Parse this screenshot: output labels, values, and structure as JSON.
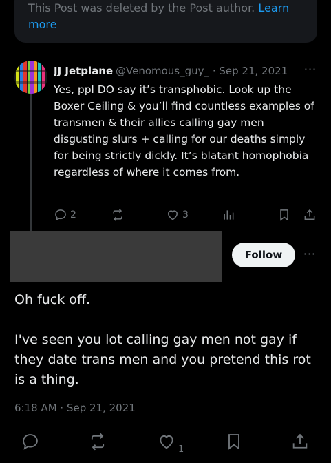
{
  "deleted_notice": {
    "text": "This Post was deleted by the Post author. ",
    "link": "Learn more"
  },
  "reply": {
    "name": "JJ Jetplane",
    "handle": "@Venomous_guy_",
    "separator": "·",
    "date": "Sep 21, 2021",
    "more": "···",
    "text": "Yes, ppl DO say it’s transphobic. Look up the Boxer Ceiling & you’ll find countless examples of transmen & their allies calling gay men disgusting slurs + calling for our deaths simply for being strictly dickly. It’s blatant homophobia regardless of where it comes from.",
    "actions": {
      "replies": "2",
      "reposts": "",
      "likes": "3"
    },
    "icons": [
      "reply-icon",
      "repost-icon",
      "like-icon",
      "views-icon",
      "bookmark-icon",
      "share-icon"
    ]
  },
  "main_post": {
    "follow_label": "Follow",
    "more": "···",
    "paragraphs": [
      "Oh fuck off.",
      "I've seen you lot calling gay men not gay if they date trans men and you pretend this rot is a thing."
    ],
    "timestamp": "6:18 AM · Sep 21, 2021"
  },
  "bottom_bar": {
    "like_count": "1",
    "icons": [
      "reply-icon",
      "repost-icon",
      "like-icon",
      "bookmark-icon",
      "share-icon"
    ]
  },
  "colors": {
    "background": "#000000",
    "text": "#e7e9ea",
    "muted": "#71767b",
    "link": "#1d9bf0",
    "follow_bg": "#eff3f4"
  }
}
